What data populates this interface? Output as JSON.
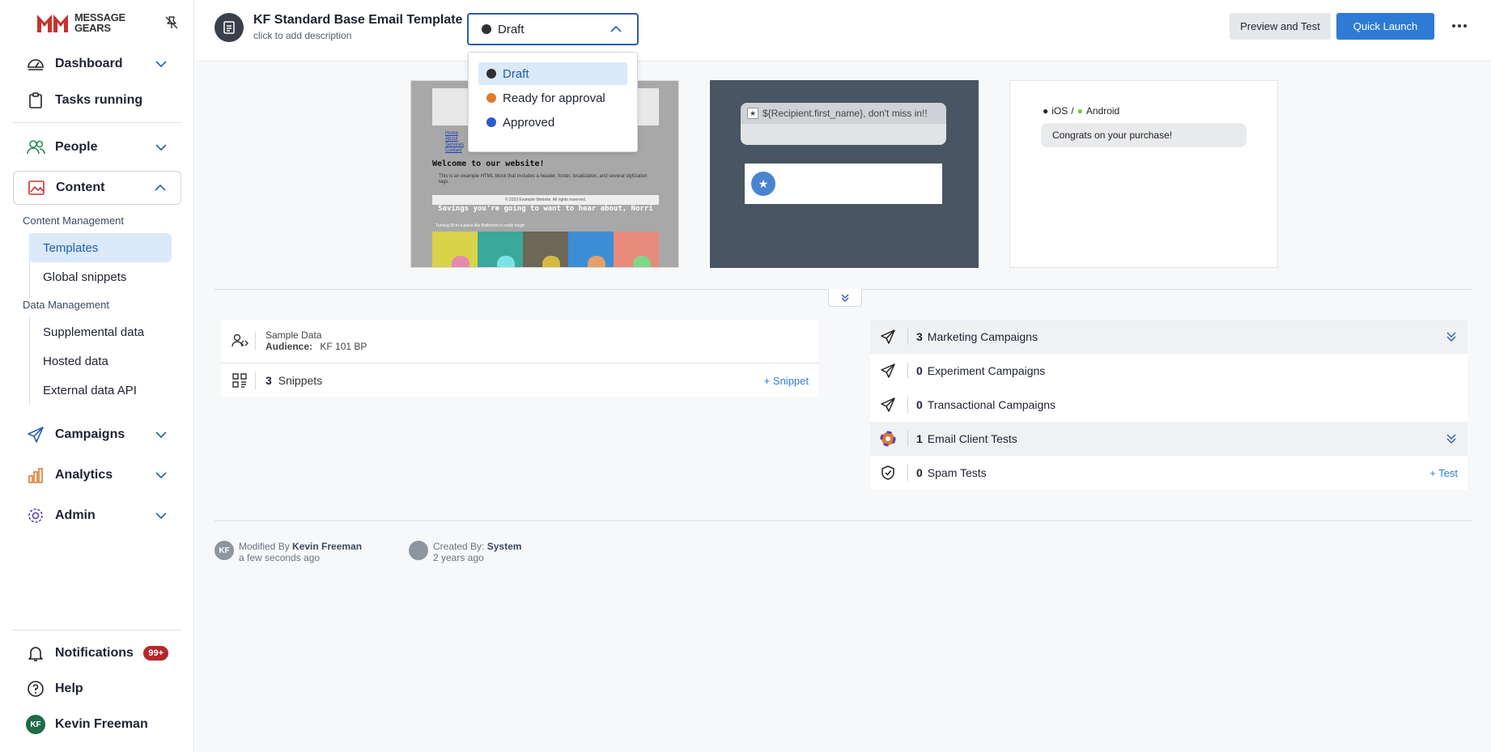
{
  "sidebar": {
    "logo_text_1": "MESSAGE",
    "logo_text_2": "GEARS",
    "nav": {
      "dashboard": "Dashboard",
      "tasks": "Tasks running",
      "people": "People",
      "content": "Content",
      "campaigns": "Campaigns",
      "analytics": "Analytics",
      "admin": "Admin"
    },
    "content_management_label": "Content Management",
    "content_items": [
      "Templates",
      "Global snippets"
    ],
    "data_management_label": "Data Management",
    "data_items": [
      "Supplemental data",
      "Hosted data",
      "External data API"
    ],
    "notifications": "Notifications",
    "notifications_badge": "99+",
    "help": "Help",
    "user_initials": "KF",
    "user_name": "Kevin Freeman"
  },
  "header": {
    "title": "KF Standard Base Email Template",
    "subtitle": "click to add description",
    "status": "Draft",
    "preview_button": "Preview and Test",
    "launch_button": "Quick Launch"
  },
  "status_dropdown": {
    "options": [
      {
        "label": "Draft",
        "color": "#2f3033"
      },
      {
        "label": "Ready for approval",
        "color": "#e07a2e"
      },
      {
        "label": "Approved",
        "color": "#2d5ac9"
      }
    ]
  },
  "email_preview": {
    "links": [
      "Home",
      "About",
      "Services",
      "Contact"
    ],
    "heading": "Welcome to our website!",
    "body": "This is an example HTML block that includes a header, footer, localization, and several stylization tags.",
    "copyright": "© 2023 Example Website. All rights reserved.",
    "banner": "Savings you're going to want to hear about, Norri",
    "small": "Turning 99 in a place like Baltimore is really tough"
  },
  "push_preview": {
    "notification_text": "${Recipient.first_name}, don't miss in!!"
  },
  "sms_preview": {
    "platforms_ios": "iOS",
    "platforms_sep": "/",
    "platforms_android": "Android",
    "message": "Congrats on your purchase!"
  },
  "sample_data": {
    "label": "Sample Data",
    "audience_label": "Audience:",
    "audience_value": "KF 101 BP"
  },
  "snippets": {
    "count": "3",
    "label": "Snippets",
    "action": "+ Snippet"
  },
  "campaigns": [
    {
      "count": "3",
      "label": "Marketing Campaigns",
      "action": ""
    },
    {
      "count": "0",
      "label": "Experiment Campaigns",
      "action": ""
    },
    {
      "count": "0",
      "label": "Transactional Campaigns",
      "action": ""
    },
    {
      "count": "1",
      "label": "Email Client Tests",
      "action": ""
    },
    {
      "count": "0",
      "label": "Spam Tests",
      "action": "+ Test"
    }
  ],
  "meta": {
    "modified_prefix": "Modified By",
    "modified_by": "Kevin Freeman",
    "modified_when": "a few seconds ago",
    "modified_initials": "KF",
    "created_prefix": "Created By:",
    "created_by": "System",
    "created_when": "2 years ago"
  },
  "colors": {
    "accent": "#2e7bd6",
    "selected_bg": "#dbe9f8",
    "badge": "#b3282d",
    "logo_red": "#c8332f"
  }
}
